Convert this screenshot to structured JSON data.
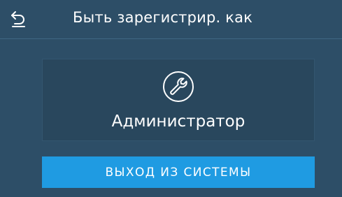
{
  "header": {
    "back_icon": "back-arrow-icon",
    "title": "Быть зарегистрир. как"
  },
  "user_panel": {
    "icon": "wrench-icon",
    "role": "Администратор"
  },
  "logout_button": {
    "label": "ВЫХОД ИЗ СИСТЕМЫ"
  },
  "colors": {
    "background": "#2d4e67",
    "panel": "#29475d",
    "button": "#1f9be2",
    "text": "#ffffff"
  }
}
